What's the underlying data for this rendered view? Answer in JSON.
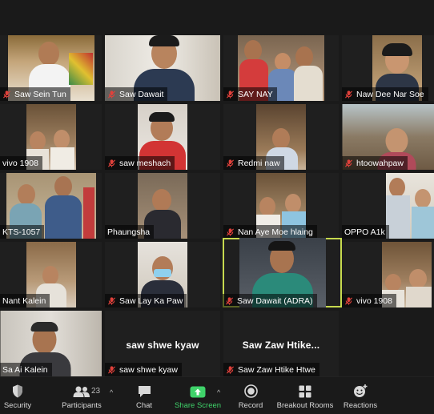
{
  "participants": [
    {
      "name": "Saw Sein Tun"
    },
    {
      "name": "Saw Dawait"
    },
    {
      "name": "SAY NAY"
    },
    {
      "name": "Naw Dee Nar Soe"
    },
    {
      "name": "vivo 1908"
    },
    {
      "name": "saw meshach"
    },
    {
      "name": "Redmi naw"
    },
    {
      "name": "htoowahpaw"
    },
    {
      "name": "KTS-1057"
    },
    {
      "name": "Phaungsha"
    },
    {
      "name": "Nan Aye Moe hlaing"
    },
    {
      "name": "OPPO A1k"
    },
    {
      "name": "Nant Kalein"
    },
    {
      "name": "Saw Lay Ka Paw"
    },
    {
      "name": "Saw Dawait (ADRA)"
    },
    {
      "name": "vivo 1908"
    },
    {
      "name": "Sa Ai Kalein"
    },
    {
      "name": "saw shwe kyaw",
      "display": "saw shwe kyaw"
    },
    {
      "name": "Saw Zaw Htike Htwe",
      "display": "Saw  Zaw  Htike..."
    }
  ],
  "toolbar": {
    "security": "Security",
    "participants": "Participants",
    "participants_count": "23",
    "chat": "Chat",
    "share_screen": "Share Screen",
    "record": "Record",
    "breakout_rooms": "Breakout Rooms",
    "reactions": "Reactions"
  },
  "colors": {
    "active_speaker_border": "#c6d94e",
    "share_green": "#3fd36a",
    "muted_red": "#e0413b"
  }
}
